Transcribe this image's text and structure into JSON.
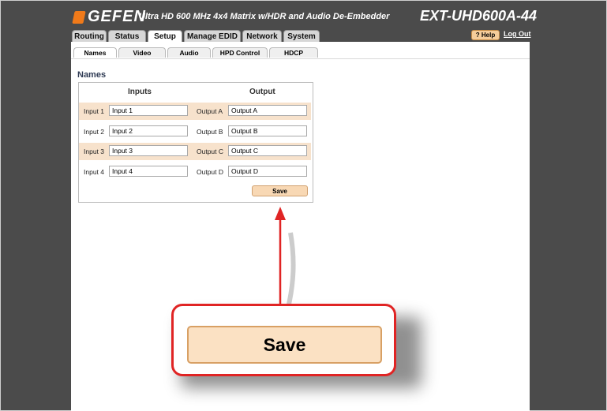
{
  "header": {
    "brand": "GEFEN",
    "description": "Ultra HD 600 MHz 4x4 Matrix w/HDR and Audio De-Embedder",
    "model": "EXT-UHD600A-44"
  },
  "tabs": [
    {
      "label": "Routing"
    },
    {
      "label": "Status"
    },
    {
      "label": "Setup"
    },
    {
      "label": "Manage EDID"
    },
    {
      "label": "Network"
    },
    {
      "label": "System"
    }
  ],
  "top_actions": {
    "help": "? Help",
    "logout": "Log Out"
  },
  "subtabs": [
    {
      "label": "Names"
    },
    {
      "label": "Video"
    },
    {
      "label": "Audio"
    },
    {
      "label": "HPD Control"
    },
    {
      "label": "HDCP"
    }
  ],
  "names": {
    "section_title": "Names",
    "inputs_header": "Inputs",
    "output_header": "Output",
    "rows": [
      {
        "input_label": "Input 1",
        "input_value": "Input 1",
        "output_label": "Output A",
        "output_value": "Output A"
      },
      {
        "input_label": "Input 2",
        "input_value": "Input 2",
        "output_label": "Output B",
        "output_value": "Output B"
      },
      {
        "input_label": "Input 3",
        "input_value": "Input 3",
        "output_label": "Output C",
        "output_value": "Output C"
      },
      {
        "input_label": "Input 4",
        "input_value": "Input 4",
        "output_label": "Output D",
        "output_value": "Output D"
      }
    ],
    "save_label": "Save"
  },
  "callout": {
    "zoomed_button_label": "Save"
  },
  "colors": {
    "accent_orange": "#f07a1a",
    "highlight_red": "#e02424",
    "row_highlight": "#f7e2cc"
  }
}
